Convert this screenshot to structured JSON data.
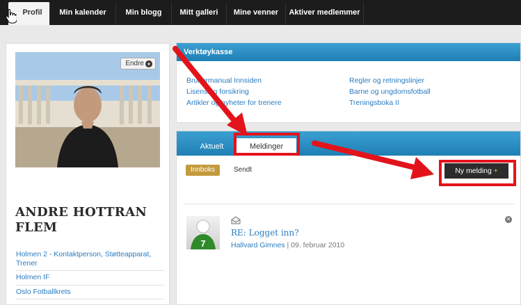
{
  "topnav": {
    "tabs": [
      {
        "label": "Profil",
        "active": true
      },
      {
        "label": "Min kalender"
      },
      {
        "label": "Min blogg"
      },
      {
        "label": "Mitt galleri"
      },
      {
        "label": "Mine venner"
      },
      {
        "label": "Aktiver medlemmer"
      }
    ]
  },
  "profile": {
    "edit_label": "Endre",
    "edit_icon": "plus-circle-icon",
    "name": "ANDRE HOTTRAN FLEM",
    "affiliations": [
      "Holmen 2 - Kontaktperson, Støtteapparat, Trener",
      "Holmen IF",
      "Oslo Fotballkrets"
    ]
  },
  "toolbox": {
    "title": "Verktøykasse",
    "links_left": [
      "Brukermanual Innsiden",
      "Lisensing forsikring",
      "Artikler og nyheter for trenere"
    ],
    "links_right": [
      "Regler og retningslinjer",
      "Barne og ungdomsfotball",
      "Treningsboka II"
    ]
  },
  "messages": {
    "tabs": [
      {
        "label": "Aktuelt"
      },
      {
        "label": "Meldinger",
        "active": true
      }
    ],
    "inbox_label": "Innboks",
    "sent_label": "Sendt",
    "new_message_label": "Ny melding",
    "new_message_plus": "+",
    "items": [
      {
        "title": "RE: Logget inn?",
        "sender": "Hallvard Gimnes",
        "date": "09. februar 2010",
        "avatar_number": "7"
      }
    ]
  },
  "colors": {
    "accent_blue": "#2a7cc0",
    "header_blue": "#1f7fb5",
    "annotation_red": "#e3131b",
    "inbox_gold": "#c39a3c"
  }
}
